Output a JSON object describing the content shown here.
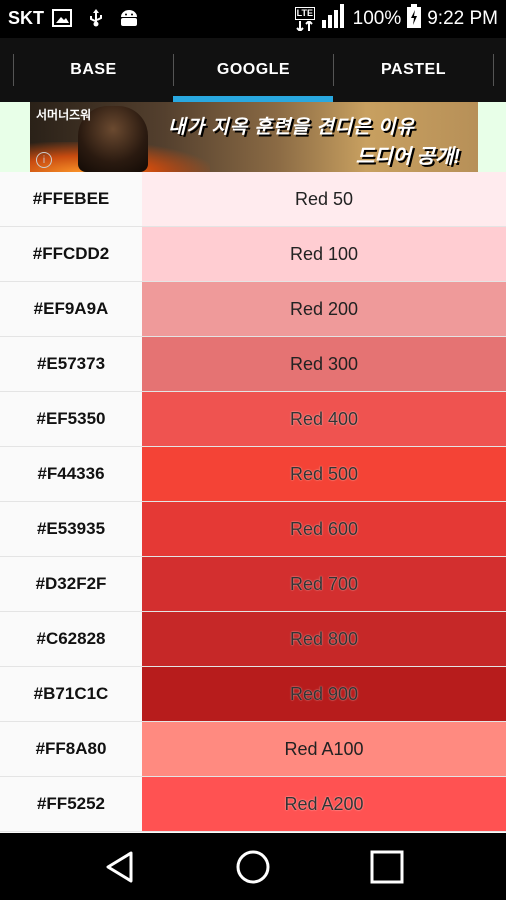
{
  "status_bar": {
    "carrier": "SKT",
    "network": "LTE",
    "battery": "100%",
    "time": "9:22 PM"
  },
  "tabs": [
    {
      "label": "BASE"
    },
    {
      "label": "GOOGLE"
    },
    {
      "label": "PASTEL"
    }
  ],
  "selected_tab": "GOOGLE",
  "ad": {
    "small_text": "서머너즈워",
    "headline": "내가 지옥 훈련을 견디은 이유",
    "headline2": "드디어 공개!"
  },
  "colors": [
    {
      "hex": "#FFEBEE",
      "name": "Red 50"
    },
    {
      "hex": "#FFCDD2",
      "name": "Red 100"
    },
    {
      "hex": "#EF9A9A",
      "name": "Red 200"
    },
    {
      "hex": "#E57373",
      "name": "Red 300"
    },
    {
      "hex": "#EF5350",
      "name": "Red 400"
    },
    {
      "hex": "#F44336",
      "name": "Red 500"
    },
    {
      "hex": "#E53935",
      "name": "Red 600"
    },
    {
      "hex": "#D32F2F",
      "name": "Red 700"
    },
    {
      "hex": "#C62828",
      "name": "Red 800"
    },
    {
      "hex": "#B71C1C",
      "name": "Red 900"
    },
    {
      "hex": "#FF8A80",
      "name": "Red A100"
    },
    {
      "hex": "#FF5252",
      "name": "Red A200"
    }
  ],
  "accent_color": "#29A8E0",
  "nav_icons": [
    "back-icon",
    "home-icon",
    "recents-icon"
  ]
}
